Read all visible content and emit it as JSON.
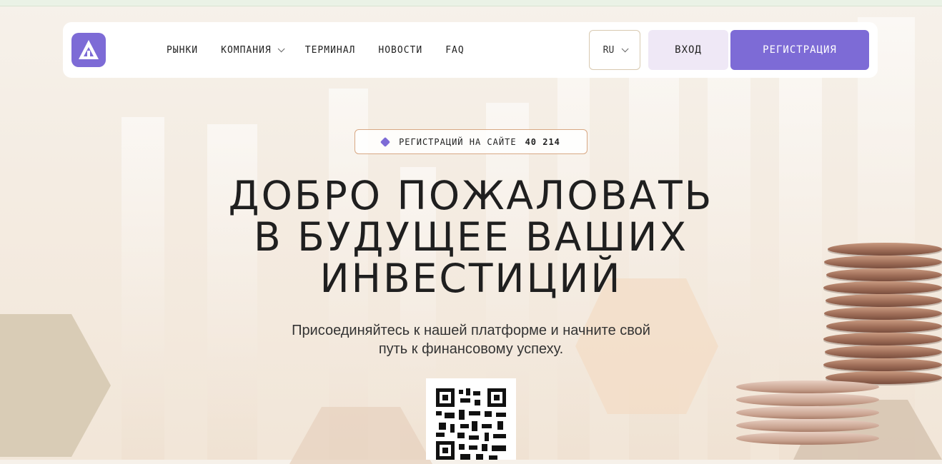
{
  "nav": {
    "logo_alt": "logo",
    "menu": [
      {
        "label": "РЫНКИ",
        "has_dropdown": false
      },
      {
        "label": "КОМПАНИЯ",
        "has_dropdown": true
      },
      {
        "label": "ТЕРМИНАЛ",
        "has_dropdown": false
      },
      {
        "label": "НОВОСТИ",
        "has_dropdown": false
      },
      {
        "label": "FAQ",
        "has_dropdown": false
      }
    ],
    "language": "RU",
    "login_label": "ВХОД",
    "register_label": "РЕГИСТРАЦИЯ"
  },
  "badge": {
    "text": "РЕГИСТРАЦИЙ НА САЙТЕ",
    "count": "40 214"
  },
  "hero": {
    "title_lines": [
      "ДОБРО ПОЖАЛОВАТЬ",
      "В БУДУЩЕЕ ВАШИХ",
      "ИНВЕСТИЦИЙ"
    ],
    "subtitle_lines": [
      "Присоединяйтесь к нашей платформе и начните свой",
      "путь к финансовому успеху."
    ]
  },
  "colors": {
    "accent": "#7d6bd6",
    "login_bg": "#efe8f6",
    "badge_border": "#d8a884"
  },
  "icons": {
    "logo": "triangle-arrow-logo",
    "dropdown": "chevron-down-icon",
    "badge": "diamond-icon",
    "qr": "qr-code"
  }
}
